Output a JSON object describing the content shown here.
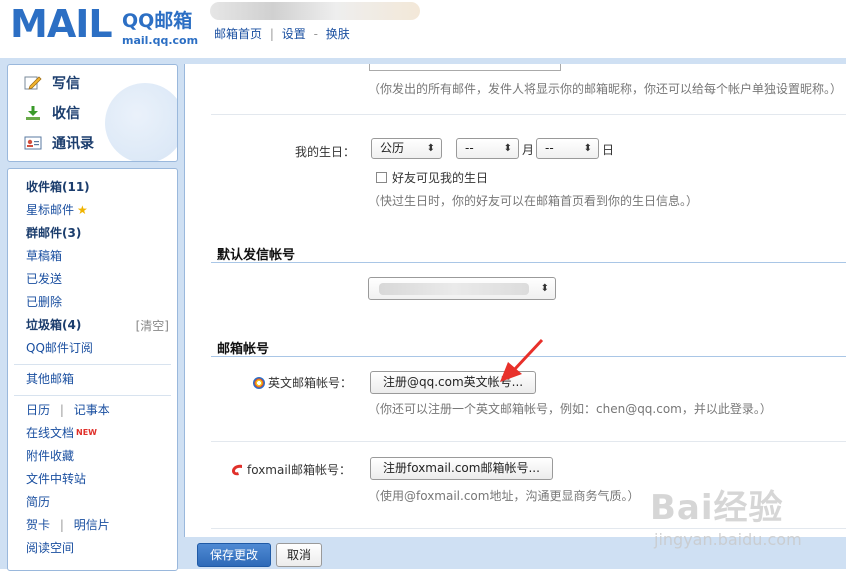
{
  "header": {
    "logo_mark": "MAIL",
    "logo_cn": "QQ邮箱",
    "logo_domain": "mail.qq.com",
    "links": {
      "home": "邮箱首页",
      "settings": "设置",
      "skin": "换肤",
      "sep1": "|",
      "sep2": "-"
    }
  },
  "nav": {
    "compose": "写信",
    "inbox": "收信",
    "contacts": "通讯录"
  },
  "folders": {
    "inbox": "收件箱(11)",
    "starred": "星标邮件",
    "group": "群邮件(3)",
    "drafts": "草稿箱",
    "sent": "已发送",
    "deleted": "已删除",
    "spam": "垃圾箱(4)",
    "spam_clear": "[清空]",
    "subscription": "QQ邮件订阅",
    "other_mail": "其他邮箱",
    "calendar": "日历",
    "notes": "记事本",
    "sep": "|",
    "online_docs": "在线文档",
    "new_badge": "NEW",
    "attachments": "附件收藏",
    "file_transfer": "文件中转站",
    "resume": "简历",
    "greeting_card": "贺卡",
    "postcard": "明信片",
    "reading": "阅读空间"
  },
  "main": {
    "nickname_hint": "（你发出的所有邮件，发件人将显示你的邮箱昵称，你还可以给每个帐户单独设置昵称。）",
    "birthday": {
      "label": "我的生日：",
      "calendar_type": "公历",
      "month_value": "--",
      "month_unit": "月",
      "day_value": "--",
      "day_unit": "日",
      "visible_label": "好友可见我的生日",
      "hint": "（快过生日时，你的好友可以在邮箱首页看到你的生日信息。）"
    },
    "default_sender": {
      "title": "默认发信帐号"
    },
    "mail_accounts": {
      "title": "邮箱帐号",
      "english_label": "英文邮箱帐号：",
      "english_button": "注册@qq.com英文帐号...",
      "english_hint": "（你还可以注册一个英文邮箱帐号，例如：chen@qq.com，并以此登录。）",
      "foxmail_label": "foxmail邮箱帐号：",
      "foxmail_button": "注册foxmail.com邮箱帐号...",
      "foxmail_hint": "（使用@foxmail.com地址，沟通更显商务气质。）"
    }
  },
  "bottom": {
    "save": "保存更改",
    "cancel": "取消"
  },
  "watermark": {
    "logo": "Bai经验",
    "url": "jingyan.baidu.com"
  },
  "colors": {
    "brand_blue": "#2c6fc4",
    "frame_blue": "#cfe0f3",
    "primary_button": "#2e6ab8",
    "arrow_red": "#e8302a"
  }
}
